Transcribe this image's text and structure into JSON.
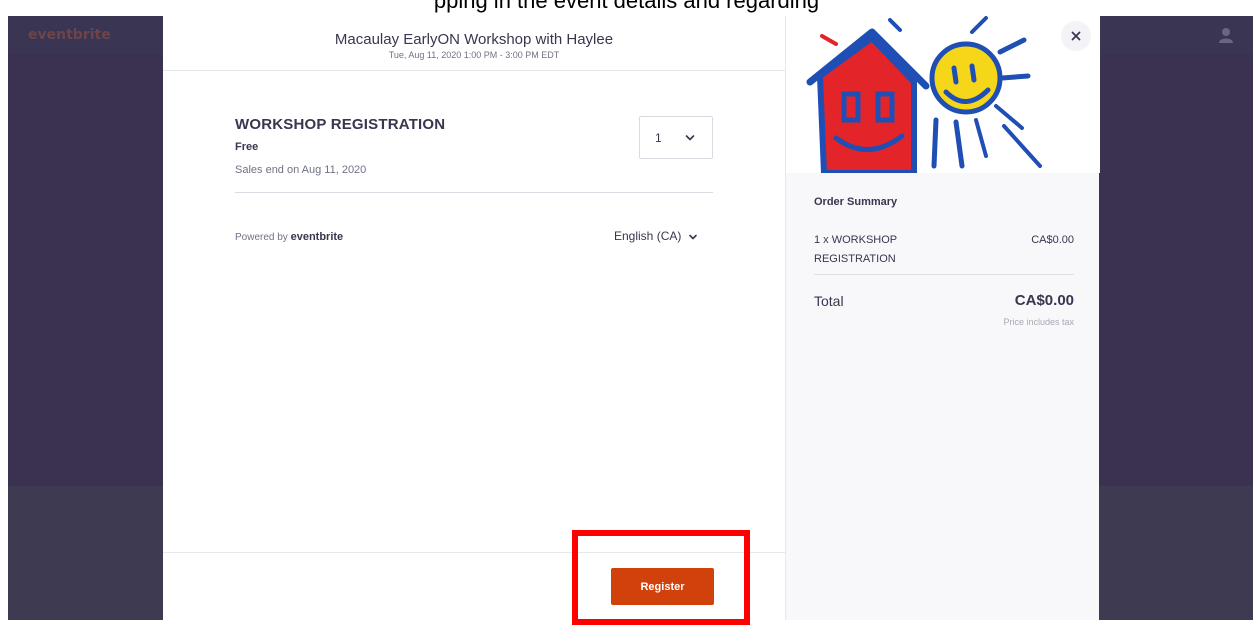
{
  "caption": "pping in the event details and regarding",
  "header": {
    "title": "Macaulay EarlyON Workshop with Haylee",
    "subtitle": "Tue, Aug 11, 2020 1:00 PM - 3:00 PM EDT"
  },
  "ticket": {
    "name": "WORKSHOP REGISTRATION",
    "price": "Free",
    "sales_end": "Sales end on Aug 11, 2020",
    "quantity": "1"
  },
  "footer_left": {
    "powered_prefix": "Powered by",
    "powered_brand": "eventbrite",
    "language": "English (CA)"
  },
  "actions": {
    "register_label": "Register",
    "close_label": "×"
  },
  "order_summary": {
    "title": "Order Summary",
    "item_name": "1 x WORKSHOP REGISTRATION",
    "item_price": "CA$0.00",
    "total_label": "Total",
    "total_value": "CA$0.00",
    "tax_note": "Price includes tax"
  },
  "colors": {
    "brand": "#d1410c",
    "highlight": "#ff0000",
    "text": "#39364f",
    "muted": "#6f7287"
  },
  "icons": {
    "qty_dropdown": "chevron-down-icon",
    "language_dropdown": "chevron-down-icon",
    "close": "close-icon",
    "user": "user-icon"
  }
}
